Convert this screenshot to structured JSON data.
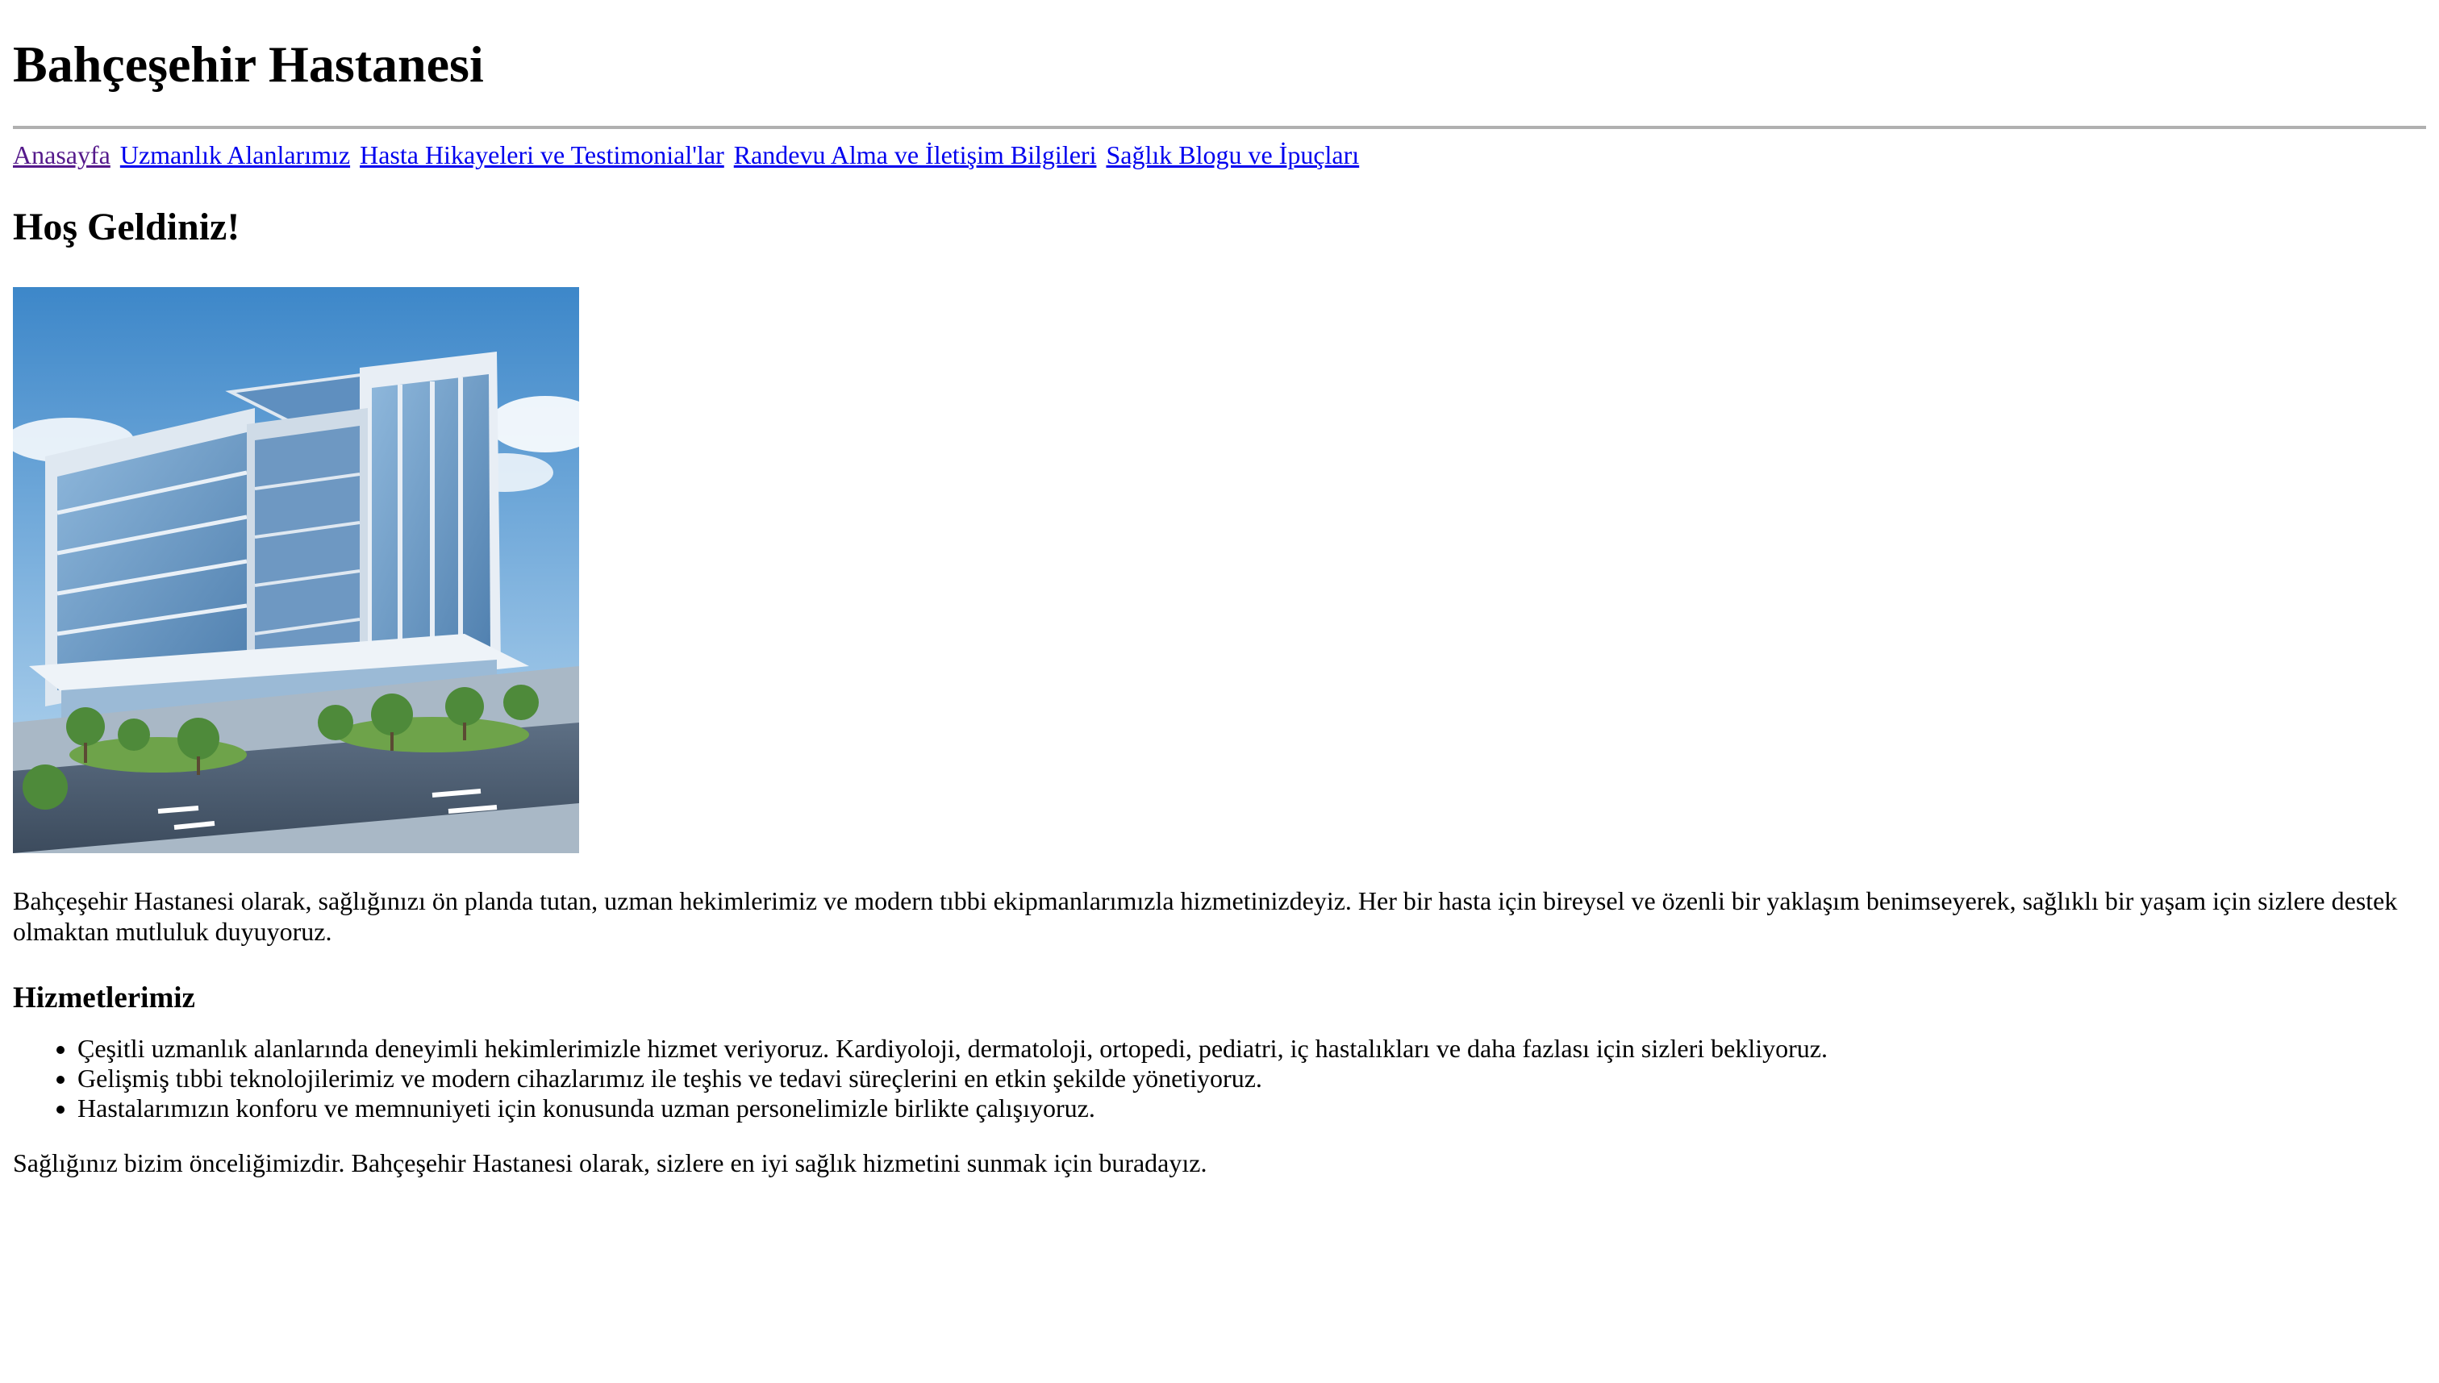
{
  "header": {
    "title": "Bahçeşehir Hastanesi"
  },
  "nav": {
    "items": [
      {
        "label": "Anasayfa",
        "state": "visited"
      },
      {
        "label": "Uzmanlık Alanlarımız"
      },
      {
        "label": "Hasta Hikayeleri ve Testimonial'lar"
      },
      {
        "label": "Randevu Alma ve İletişim Bilgileri"
      },
      {
        "label": "Sağlık Blogu ve İpuçları"
      }
    ]
  },
  "main": {
    "welcome_heading": "Hoş Geldiniz!",
    "hero_image": {
      "subject": "modern hospital building"
    },
    "intro": "Bahçeşehir Hastanesi olarak, sağlığınızı ön planda tutan, uzman hekimlerimiz ve modern tıbbi ekipmanlarımızla hizmetinizdeyiz. Her bir hasta için bireysel ve özenli bir yaklaşım benimseyerek, sağlıklı bir yaşam için sizlere destek olmaktan mutluluk duyuyoruz.",
    "services_heading": "Hizmetlerimiz",
    "services": [
      "Çeşitli uzmanlık alanlarında deneyimli hekimlerimizle hizmet veriyoruz. Kardiyoloji, dermatoloji, ortopedi, pediatri, iç hastalıkları ve daha fazlası için sizleri bekliyoruz.",
      "Gelişmiş tıbbi teknolojilerimiz ve modern cihazlarımız ile teşhis ve tedavi süreçlerini en etkin şekilde yönetiyoruz.",
      "Hastalarımızın konforu ve memnuniyeti için konusunda uzman personelimizle birlikte çalışıyoruz."
    ],
    "closing": "Sağlığınız bizim önceliğimizdir. Bahçeşehir Hastanesi olarak, sizlere en iyi sağlık hizmetini sunmak için buradayız."
  },
  "colors": {
    "link": "#0000ee",
    "link_visited": "#551a8b",
    "divider": "#b0b0b0"
  }
}
